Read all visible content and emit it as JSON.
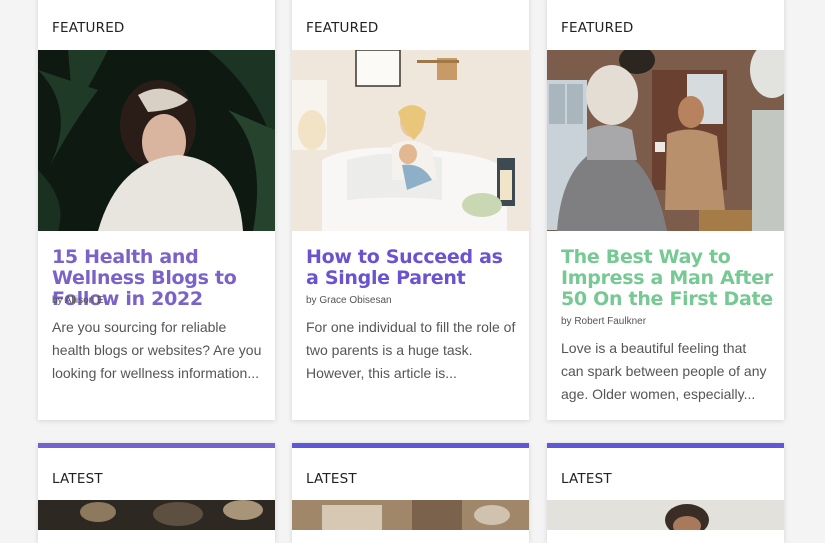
{
  "featured_cards": [
    {
      "label": "FEATURED",
      "title": "15 Health and Wellness Blogs to Follow in 2022",
      "author": "by Allison E.",
      "excerpt": "Are you sourcing for reliable health blogs or websites? Are you looking for wellness information...",
      "accent_color": "#6c5ad6",
      "title_color": "#7b62c9"
    },
    {
      "label": "FEATURED",
      "title": "How to Succeed as a Single Parent",
      "author": "by Grace Obisesan",
      "excerpt": "For one individual to fill the role of two parents is a huge task. However, this article is...",
      "accent_color": "#6c5ad6",
      "title_color": "#6b52d0"
    },
    {
      "label": "FEATURED",
      "title": "The Best Way to Impress a Man After 50 On the First Date",
      "author": "by Robert Faulkner",
      "excerpt": "Love is a beautiful feeling that can spark between people of any age. Older women, especially...",
      "accent_color": "#7fd19b",
      "title_color": "#76c993"
    }
  ],
  "latest_cards": [
    {
      "label": "LATEST",
      "accent_color": "#7560d0"
    },
    {
      "label": "LATEST",
      "accent_color": "#5f56d8"
    },
    {
      "label": "LATEST",
      "accent_color": "#5f56d8"
    }
  ]
}
